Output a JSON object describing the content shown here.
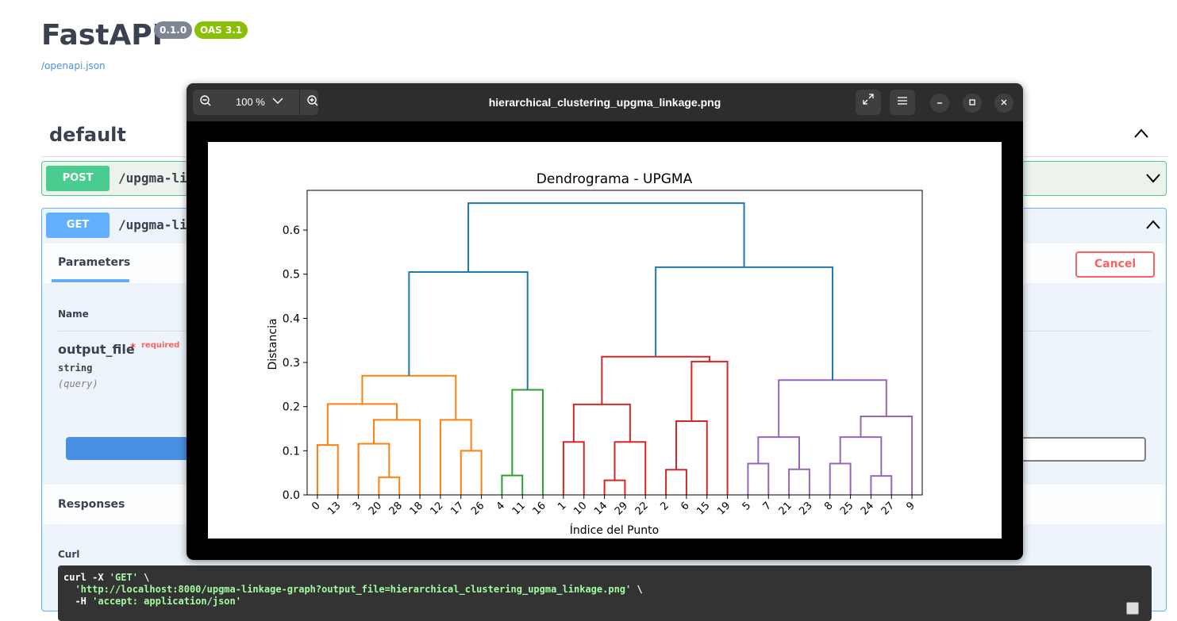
{
  "header": {
    "title": "FastAPI",
    "version_badge": "0.1.0",
    "oas_badge": "OAS 3.1",
    "spec_link": "/openapi.json"
  },
  "section": {
    "title": "default"
  },
  "operations": [
    {
      "method": "POST",
      "path": "/upgma-li"
    },
    {
      "method": "GET",
      "path": "/upgma-li"
    }
  ],
  "get_panel": {
    "tab_label": "Parameters",
    "cancel_label": "Cancel",
    "name_header": "Name",
    "param": {
      "name": "output_file",
      "required": "required",
      "type": "string",
      "in": "(query)"
    },
    "responses_title": "Responses",
    "curl_label": "Curl",
    "curl": {
      "line1_cmd": "curl -X ",
      "line1_method": "'GET'",
      "line1_tail": " \\",
      "line2": "'http://localhost:8000/upgma-linkage-graph?output_file=hierarchical_clustering_upgma_linkage.png'",
      "line2_tail": " \\",
      "line3_cmd": "-H ",
      "line3_val": "'accept: application/json'"
    }
  },
  "viewer": {
    "title": "hierarchical_clustering_upgma_linkage.png",
    "zoom": "100 %"
  },
  "colors": {
    "orange": "#ff7f0e",
    "green": "#2ca02c",
    "red": "#d62728",
    "purple": "#9467bd",
    "blue": "#1f77b4"
  },
  "chart_data": {
    "type": "dendrogram",
    "title": "Dendrograma - UPGMA",
    "xlabel": "Índice del Punto",
    "ylabel": "Distancia",
    "ylim": [
      0,
      0.69
    ],
    "yticks": [
      0.0,
      0.1,
      0.2,
      0.3,
      0.4,
      0.5,
      0.6
    ],
    "leaves": [
      "0",
      "13",
      "3",
      "20",
      "28",
      "18",
      "12",
      "17",
      "26",
      "4",
      "11",
      "16",
      "1",
      "10",
      "14",
      "29",
      "22",
      "2",
      "6",
      "15",
      "19",
      "5",
      "7",
      "21",
      "23",
      "8",
      "25",
      "24",
      "27",
      "9"
    ],
    "links": [
      {
        "a": "L0",
        "b": "L1",
        "h": 0.113,
        "c": "orange"
      },
      {
        "a": "L3",
        "b": "L4",
        "h": 0.04,
        "c": "orange"
      },
      {
        "a": "L2",
        "b": "N1",
        "h": 0.116,
        "c": "orange"
      },
      {
        "a": "N2",
        "b": "L5",
        "h": 0.17,
        "c": "orange"
      },
      {
        "a": "N0",
        "b": "N3",
        "h": 0.206,
        "c": "orange"
      },
      {
        "a": "L7",
        "b": "L8",
        "h": 0.1,
        "c": "orange"
      },
      {
        "a": "L6",
        "b": "N5",
        "h": 0.17,
        "c": "orange"
      },
      {
        "a": "N4",
        "b": "N6",
        "h": 0.27,
        "c": "orange"
      },
      {
        "a": "L9",
        "b": "L10",
        "h": 0.044,
        "c": "green"
      },
      {
        "a": "N8",
        "b": "L11",
        "h": 0.238,
        "c": "green"
      },
      {
        "a": "L12",
        "b": "L13",
        "h": 0.12,
        "c": "red"
      },
      {
        "a": "L14",
        "b": "L15",
        "h": 0.033,
        "c": "red"
      },
      {
        "a": "N11",
        "b": "L16",
        "h": 0.12,
        "c": "red"
      },
      {
        "a": "N10",
        "b": "N12",
        "h": 0.205,
        "c": "red"
      },
      {
        "a": "L17",
        "b": "L18",
        "h": 0.057,
        "c": "red"
      },
      {
        "a": "N14",
        "b": "L19",
        "h": 0.167,
        "c": "red"
      },
      {
        "a": "N15",
        "b": "L20",
        "h": 0.302,
        "c": "red"
      },
      {
        "a": "N13",
        "b": "N16",
        "h": 0.313,
        "c": "red"
      },
      {
        "a": "L21",
        "b": "L22",
        "h": 0.071,
        "c": "purple"
      },
      {
        "a": "L23",
        "b": "L24",
        "h": 0.058,
        "c": "purple"
      },
      {
        "a": "N18",
        "b": "N19",
        "h": 0.131,
        "c": "purple"
      },
      {
        "a": "L25",
        "b": "L26",
        "h": 0.071,
        "c": "purple"
      },
      {
        "a": "L27",
        "b": "L28",
        "h": 0.043,
        "c": "purple"
      },
      {
        "a": "N21",
        "b": "N22",
        "h": 0.131,
        "c": "purple"
      },
      {
        "a": "N23",
        "b": "L29",
        "h": 0.178,
        "c": "purple"
      },
      {
        "a": "N20",
        "b": "N24",
        "h": 0.26,
        "c": "purple"
      },
      {
        "a": "N7",
        "b": "N9",
        "h": 0.505,
        "c": "blue"
      },
      {
        "a": "N17",
        "b": "N25",
        "h": 0.516,
        "c": "blue"
      },
      {
        "a": "N26",
        "b": "N27",
        "h": 0.661,
        "c": "blue"
      }
    ]
  }
}
